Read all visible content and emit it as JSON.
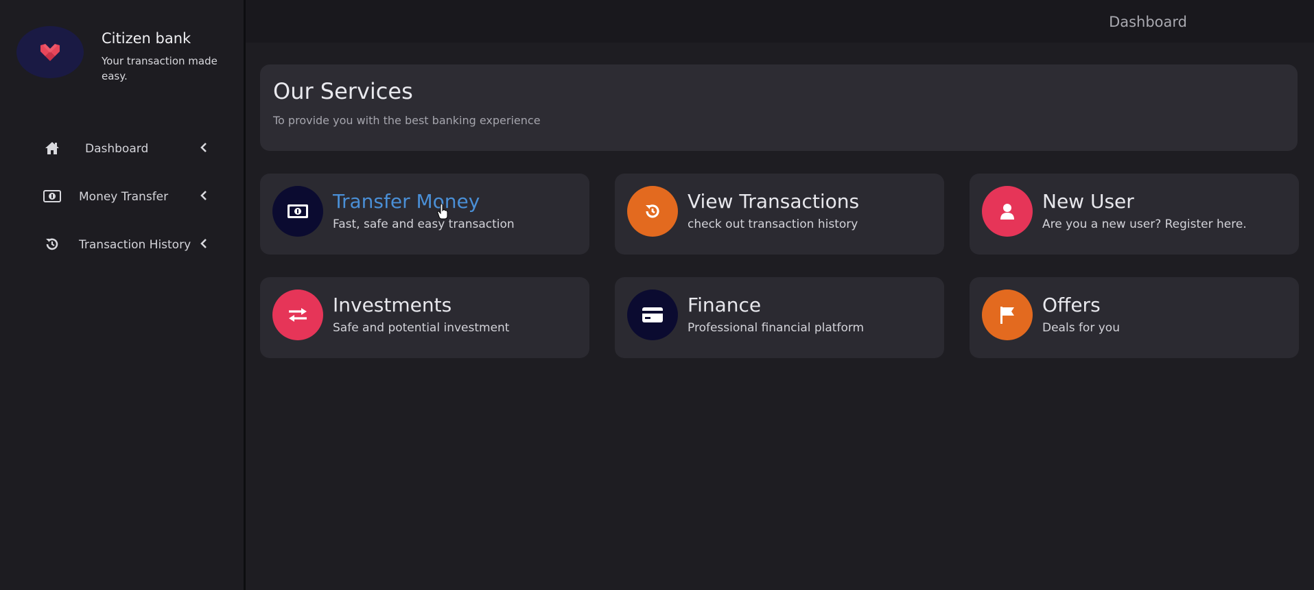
{
  "brand": {
    "name": "Citizen bank",
    "tagline": "Your transaction made easy.",
    "logo_icon": "m-logo-icon",
    "logo_color": "#e8465a"
  },
  "topbar": {
    "title": "Dashboard"
  },
  "sidebar": {
    "items": [
      {
        "label": "Dashboard",
        "icon": "home-icon"
      },
      {
        "label": "Money Transfer",
        "icon": "money-bill-icon"
      },
      {
        "label": "Transaction History",
        "icon": "history-icon"
      }
    ]
  },
  "hero": {
    "title": "Our Services",
    "subtitle": "To provide you with the best banking experience"
  },
  "services": [
    {
      "title": "Transfer Money",
      "description": "Fast, safe and easy transaction",
      "icon": "money-bill-icon",
      "color": "#0b0b30",
      "active": true
    },
    {
      "title": "View Transactions",
      "description": "check out transaction history",
      "icon": "history-icon",
      "color": "#e36a1f"
    },
    {
      "title": "New User",
      "description": "Are you a new user? Register here.",
      "icon": "user-icon",
      "color": "#e63558"
    },
    {
      "title": "Investments",
      "description": "Safe and potential investment",
      "icon": "exchange-icon",
      "color": "#e63558"
    },
    {
      "title": "Finance",
      "description": "Professional financial platform",
      "icon": "credit-card-icon",
      "color": "#0b0b30"
    },
    {
      "title": "Offers",
      "description": "Deals for you",
      "icon": "flag-icon",
      "color": "#e36a1f"
    }
  ]
}
